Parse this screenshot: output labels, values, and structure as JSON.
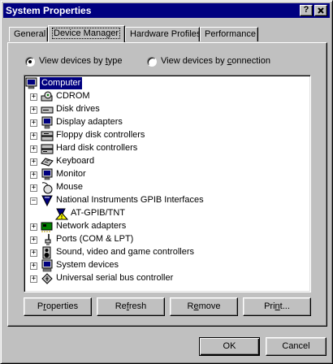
{
  "window": {
    "title": "System Properties",
    "help_label": "?",
    "close_label": "x"
  },
  "tabs": [
    {
      "label": "General",
      "active": false
    },
    {
      "label": "Device Manager",
      "active": true
    },
    {
      "label": "Hardware Profiles",
      "active": false
    },
    {
      "label": "Performance",
      "active": false
    }
  ],
  "view": {
    "by_type_pre": "View devices by ",
    "by_type_key": "t",
    "by_type_post": "ype",
    "by_connection_pre": "View devices by ",
    "by_connection_key": "c",
    "by_connection_post": "onnection",
    "selected": "by_type"
  },
  "tree": {
    "root": "Computer",
    "items": [
      {
        "label": "CDROM",
        "expand": "+",
        "icon": "cdrom-icon"
      },
      {
        "label": "Disk drives",
        "expand": "+",
        "icon": "disk-drive-icon"
      },
      {
        "label": "Display adapters",
        "expand": "+",
        "icon": "display-adapter-icon"
      },
      {
        "label": "Floppy disk controllers",
        "expand": "+",
        "icon": "floppy-controller-icon"
      },
      {
        "label": "Hard disk controllers",
        "expand": "+",
        "icon": "hard-disk-controller-icon"
      },
      {
        "label": "Keyboard",
        "expand": "+",
        "icon": "keyboard-icon"
      },
      {
        "label": "Monitor",
        "expand": "+",
        "icon": "monitor-icon"
      },
      {
        "label": "Mouse",
        "expand": "+",
        "icon": "mouse-icon"
      },
      {
        "label": "National Instruments GPIB Interfaces",
        "expand": "−",
        "icon": "gpib-icon"
      },
      {
        "label": "AT-GPIB/TNT",
        "expand": "",
        "icon": "warning-device-icon",
        "child": true
      },
      {
        "label": "Network adapters",
        "expand": "+",
        "icon": "network-adapter-icon"
      },
      {
        "label": "Ports (COM & LPT)",
        "expand": "+",
        "icon": "ports-icon"
      },
      {
        "label": "Sound, video and game controllers",
        "expand": "+",
        "icon": "sound-icon"
      },
      {
        "label": "System devices",
        "expand": "+",
        "icon": "system-devices-icon"
      },
      {
        "label": "Universal serial bus controller",
        "expand": "+",
        "icon": "usb-icon"
      }
    ]
  },
  "buttons": {
    "properties_key": "r",
    "properties_pre": "P",
    "properties_post": "operties",
    "refresh_key": "f",
    "refresh_pre": "Re",
    "refresh_post": "resh",
    "remove_key": "e",
    "remove_pre": "R",
    "remove_post": "move",
    "print_key": "n",
    "print_pre": "Pri",
    "print_post": "t...",
    "ok": "OK",
    "cancel": "Cancel"
  }
}
